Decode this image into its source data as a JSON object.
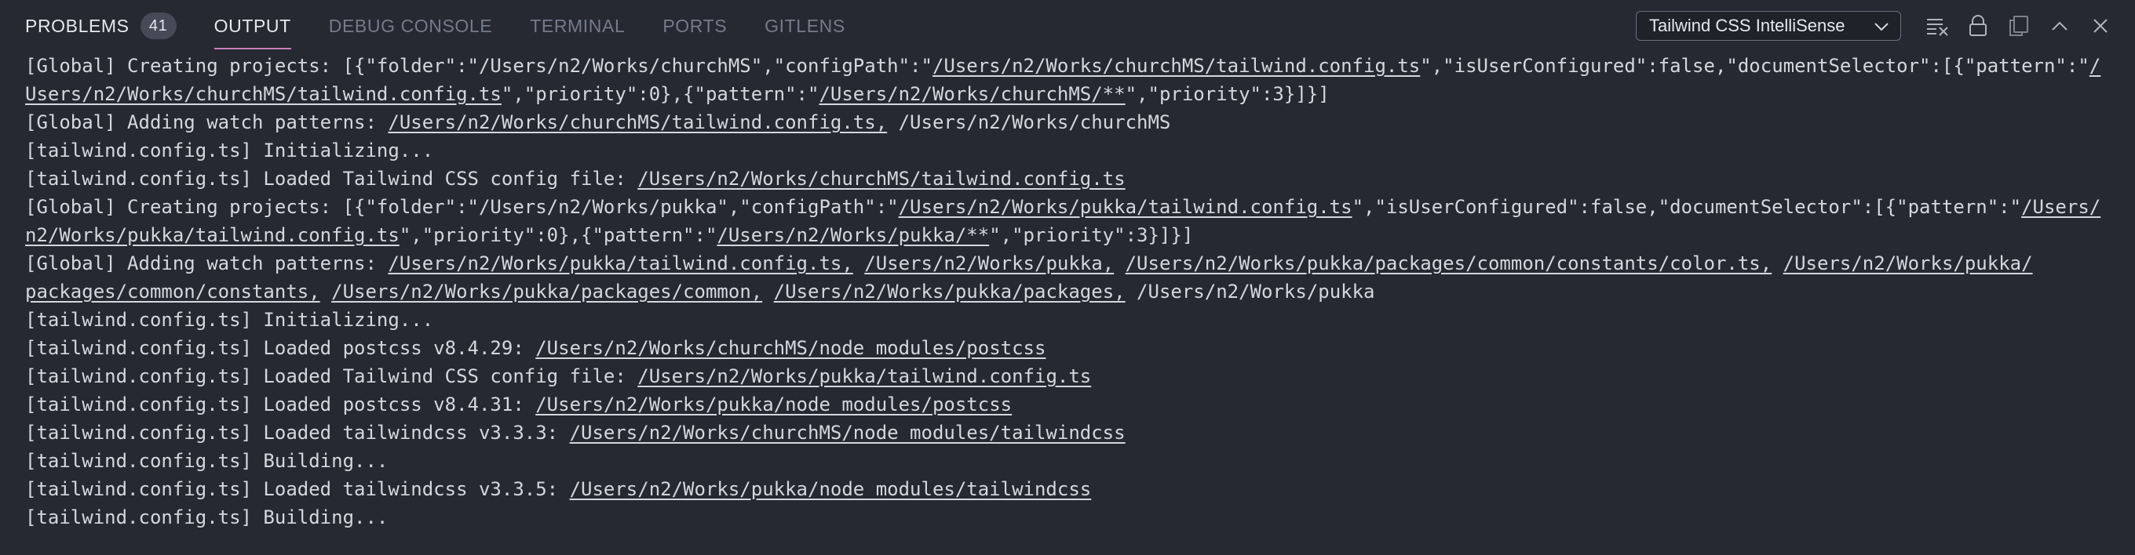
{
  "panel": {
    "tabs": [
      {
        "label": "PROBLEMS",
        "badge": "41"
      },
      {
        "label": "OUTPUT"
      },
      {
        "label": "DEBUG CONSOLE"
      },
      {
        "label": "TERMINAL"
      },
      {
        "label": "PORTS"
      },
      {
        "label": "GITLENS"
      }
    ],
    "channel_select": "Tailwind CSS IntelliSense",
    "accent_color": "#c97fb5",
    "toolbar_icons": [
      "clear-output-icon",
      "lock-icon",
      "copy-icon",
      "chevron-up-icon",
      "close-icon"
    ]
  },
  "output": {
    "lines": [
      [
        "[Global] Creating projects: [{\"folder\":\"/Users/n2/Works/churchMS\",\"configPath\":\"",
        "/Users/n2/Works/churchMS/tailwind.config.ts",
        "\",\"isUserConfigured\":false,\"documentSelector\":[{\"pattern\":\"",
        "/"
      ],
      [
        "",
        "Users/n2/Works/churchMS/tailwind.config.ts",
        "\",\"priority\":0},{\"pattern\":\"",
        "/Users/n2/Works/churchMS/**",
        "\",\"priority\":3}]}]"
      ],
      [
        "[Global] Adding watch patterns: ",
        "/Users/n2/Works/churchMS/tailwind.config.ts,",
        " /Users/n2/Works/churchMS"
      ],
      [
        "[tailwind.config.ts] Initializing..."
      ],
      [
        "[tailwind.config.ts] Loaded Tailwind CSS config file: ",
        "/Users/n2/Works/churchMS/tailwind.config.ts"
      ],
      [
        "[Global] Creating projects: [{\"folder\":\"/Users/n2/Works/pukka\",\"configPath\":\"",
        "/Users/n2/Works/pukka/tailwind.config.ts",
        "\",\"isUserConfigured\":false,\"documentSelector\":[{\"pattern\":\"",
        "/Users/"
      ],
      [
        "",
        "n2/Works/pukka/tailwind.config.ts",
        "\",\"priority\":0},{\"pattern\":\"",
        "/Users/n2/Works/pukka/**",
        "\",\"priority\":3}]}]"
      ],
      [
        "[Global] Adding watch patterns: ",
        "/Users/n2/Works/pukka/tailwind.config.ts,",
        " ",
        "/Users/n2/Works/pukka,",
        " ",
        "/Users/n2/Works/pukka/packages/common/constants/color.ts,",
        " ",
        "/Users/n2/Works/pukka/"
      ],
      [
        "",
        "packages/common/constants,",
        " ",
        "/Users/n2/Works/pukka/packages/common,",
        " ",
        "/Users/n2/Works/pukka/packages,",
        " /Users/n2/Works/pukka"
      ],
      [
        "[tailwind.config.ts] Initializing..."
      ],
      [
        "[tailwind.config.ts] Loaded postcss v8.4.29: ",
        "/Users/n2/Works/churchMS/node_modules/postcss"
      ],
      [
        "[tailwind.config.ts] Loaded Tailwind CSS config file: ",
        "/Users/n2/Works/pukka/tailwind.config.ts"
      ],
      [
        "[tailwind.config.ts] Loaded postcss v8.4.31: ",
        "/Users/n2/Works/pukka/node_modules/postcss"
      ],
      [
        "[tailwind.config.ts] Loaded tailwindcss v3.3.3: ",
        "/Users/n2/Works/churchMS/node_modules/tailwindcss"
      ],
      [
        "[tailwind.config.ts] Building..."
      ],
      [
        "[tailwind.config.ts] Loaded tailwindcss v3.3.5: ",
        "/Users/n2/Works/pukka/node_modules/tailwindcss"
      ],
      [
        "[tailwind.config.ts] Building..."
      ]
    ]
  }
}
